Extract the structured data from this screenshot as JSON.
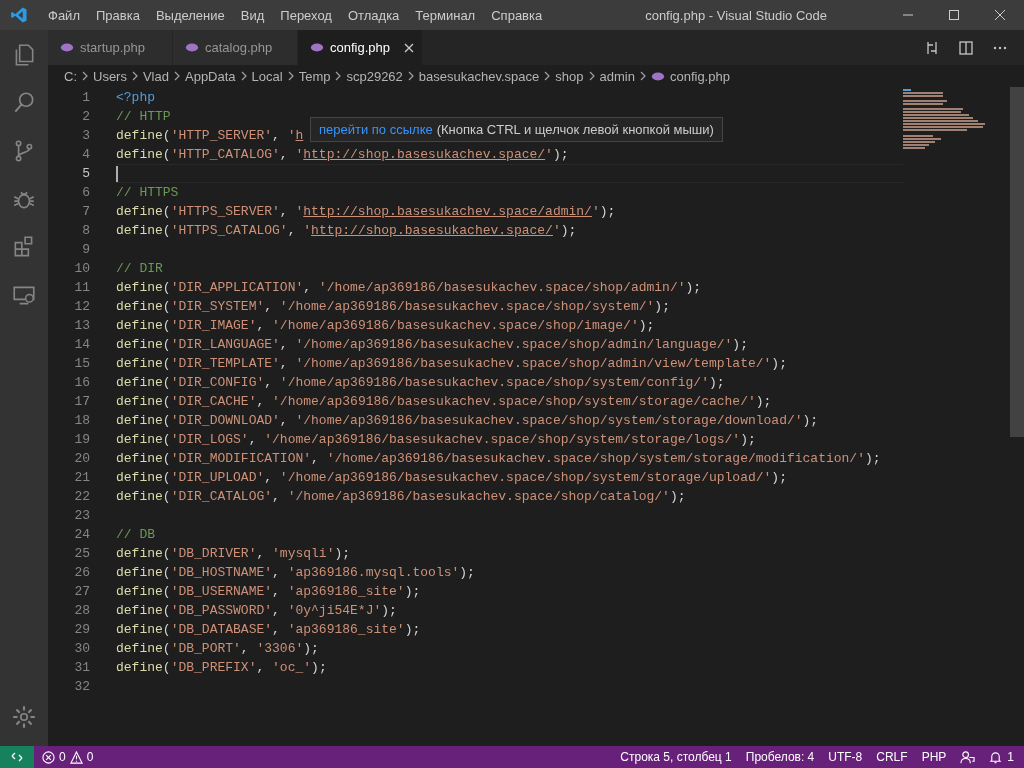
{
  "window": {
    "title": "config.php - Visual Studio Code"
  },
  "menu": [
    "Файл",
    "Правка",
    "Выделение",
    "Вид",
    "Переход",
    "Отладка",
    "Терминал",
    "Справка"
  ],
  "tabs": [
    {
      "label": "startup.php",
      "selected": false
    },
    {
      "label": "catalog.php",
      "selected": false
    },
    {
      "label": "config.php",
      "selected": true
    }
  ],
  "breadcrumbs": [
    "C:",
    "Users",
    "Vlad",
    "AppData",
    "Local",
    "Temp",
    "scp29262",
    "basesukachev.space",
    "shop",
    "admin",
    "config.php"
  ],
  "editor": {
    "lines": [
      {
        "number": "1",
        "current": false,
        "tokens": [
          {
            "kind": "tag",
            "text": "<?php"
          }
        ]
      },
      {
        "number": "2",
        "current": false,
        "tokens": [
          {
            "kind": "comment",
            "text": "// HTTP"
          }
        ]
      },
      {
        "number": "3",
        "current": false,
        "tokens": [
          {
            "kind": "func",
            "text": "define"
          },
          {
            "kind": "punct",
            "text": "("
          },
          {
            "kind": "string",
            "text": "'HTTP_SERVER'"
          },
          {
            "kind": "punct",
            "text": ", "
          },
          {
            "kind": "string",
            "text": "'"
          },
          {
            "kind": "link",
            "text": "h"
          }
        ]
      },
      {
        "number": "4",
        "current": false,
        "tokens": [
          {
            "kind": "func",
            "text": "define"
          },
          {
            "kind": "punct",
            "text": "("
          },
          {
            "kind": "string",
            "text": "'HTTP_CATALOG'"
          },
          {
            "kind": "punct",
            "text": ", "
          },
          {
            "kind": "string",
            "text": "'"
          },
          {
            "kind": "link",
            "text": "http://shop.basesukachev.space/"
          },
          {
            "kind": "string",
            "text": "'"
          },
          {
            "kind": "punct",
            "text": ");"
          }
        ]
      },
      {
        "number": "5",
        "current": true
      },
      {
        "number": "6",
        "current": false,
        "tokens": [
          {
            "kind": "comment",
            "text": "// HTTPS"
          }
        ]
      },
      {
        "number": "7",
        "current": false,
        "tokens": [
          {
            "kind": "func",
            "text": "define"
          },
          {
            "kind": "punct",
            "text": "("
          },
          {
            "kind": "string",
            "text": "'HTTPS_SERVER'"
          },
          {
            "kind": "punct",
            "text": ", "
          },
          {
            "kind": "string",
            "text": "'"
          },
          {
            "kind": "link",
            "text": "http://shop.basesukachev.space/admin/"
          },
          {
            "kind": "string",
            "text": "'"
          },
          {
            "kind": "punct",
            "text": ");"
          }
        ]
      },
      {
        "number": "8",
        "current": false,
        "tokens": [
          {
            "kind": "func",
            "text": "define"
          },
          {
            "kind": "punct",
            "text": "("
          },
          {
            "kind": "string",
            "text": "'HTTPS_CATALOG'"
          },
          {
            "kind": "punct",
            "text": ", "
          },
          {
            "kind": "string",
            "text": "'"
          },
          {
            "kind": "link",
            "text": "http://shop.basesukachev.space/"
          },
          {
            "kind": "string",
            "text": "'"
          },
          {
            "kind": "punct",
            "text": ");"
          }
        ]
      },
      {
        "number": "9",
        "current": false
      },
      {
        "number": "10",
        "current": false,
        "tokens": [
          {
            "kind": "comment",
            "text": "// DIR"
          }
        ]
      },
      {
        "number": "11",
        "current": false,
        "tokens": [
          {
            "kind": "func",
            "text": "define"
          },
          {
            "kind": "punct",
            "text": "("
          },
          {
            "kind": "string",
            "text": "'DIR_APPLICATION'"
          },
          {
            "kind": "punct",
            "text": ", "
          },
          {
            "kind": "string",
            "text": "'/home/ap369186/basesukachev.space/shop/admin/'"
          },
          {
            "kind": "punct",
            "text": ");"
          }
        ]
      },
      {
        "number": "12",
        "current": false,
        "tokens": [
          {
            "kind": "func",
            "text": "define"
          },
          {
            "kind": "punct",
            "text": "("
          },
          {
            "kind": "string",
            "text": "'DIR_SYSTEM'"
          },
          {
            "kind": "punct",
            "text": ", "
          },
          {
            "kind": "string",
            "text": "'/home/ap369186/basesukachev.space/shop/system/'"
          },
          {
            "kind": "punct",
            "text": ");"
          }
        ]
      },
      {
        "number": "13",
        "current": false,
        "tokens": [
          {
            "kind": "func",
            "text": "define"
          },
          {
            "kind": "punct",
            "text": "("
          },
          {
            "kind": "string",
            "text": "'DIR_IMAGE'"
          },
          {
            "kind": "punct",
            "text": ", "
          },
          {
            "kind": "string",
            "text": "'/home/ap369186/basesukachev.space/shop/image/'"
          },
          {
            "kind": "punct",
            "text": ");"
          }
        ]
      },
      {
        "number": "14",
        "current": false,
        "tokens": [
          {
            "kind": "func",
            "text": "define"
          },
          {
            "kind": "punct",
            "text": "("
          },
          {
            "kind": "string",
            "text": "'DIR_LANGUAGE'"
          },
          {
            "kind": "punct",
            "text": ", "
          },
          {
            "kind": "string",
            "text": "'/home/ap369186/basesukachev.space/shop/admin/language/'"
          },
          {
            "kind": "punct",
            "text": ");"
          }
        ]
      },
      {
        "number": "15",
        "current": false,
        "tokens": [
          {
            "kind": "func",
            "text": "define"
          },
          {
            "kind": "punct",
            "text": "("
          },
          {
            "kind": "string",
            "text": "'DIR_TEMPLATE'"
          },
          {
            "kind": "punct",
            "text": ", "
          },
          {
            "kind": "string",
            "text": "'/home/ap369186/basesukachev.space/shop/admin/view/template/'"
          },
          {
            "kind": "punct",
            "text": ");"
          }
        ]
      },
      {
        "number": "16",
        "current": false,
        "tokens": [
          {
            "kind": "func",
            "text": "define"
          },
          {
            "kind": "punct",
            "text": "("
          },
          {
            "kind": "string",
            "text": "'DIR_CONFIG'"
          },
          {
            "kind": "punct",
            "text": ", "
          },
          {
            "kind": "string",
            "text": "'/home/ap369186/basesukachev.space/shop/system/config/'"
          },
          {
            "kind": "punct",
            "text": ");"
          }
        ]
      },
      {
        "number": "17",
        "current": false,
        "tokens": [
          {
            "kind": "func",
            "text": "define"
          },
          {
            "kind": "punct",
            "text": "("
          },
          {
            "kind": "string",
            "text": "'DIR_CACHE'"
          },
          {
            "kind": "punct",
            "text": ", "
          },
          {
            "kind": "string",
            "text": "'/home/ap369186/basesukachev.space/shop/system/storage/cache/'"
          },
          {
            "kind": "punct",
            "text": ");"
          }
        ]
      },
      {
        "number": "18",
        "current": false,
        "tokens": [
          {
            "kind": "func",
            "text": "define"
          },
          {
            "kind": "punct",
            "text": "("
          },
          {
            "kind": "string",
            "text": "'DIR_DOWNLOAD'"
          },
          {
            "kind": "punct",
            "text": ", "
          },
          {
            "kind": "string",
            "text": "'/home/ap369186/basesukachev.space/shop/system/storage/download/'"
          },
          {
            "kind": "punct",
            "text": ");"
          }
        ]
      },
      {
        "number": "19",
        "current": false,
        "tokens": [
          {
            "kind": "func",
            "text": "define"
          },
          {
            "kind": "punct",
            "text": "("
          },
          {
            "kind": "string",
            "text": "'DIR_LOGS'"
          },
          {
            "kind": "punct",
            "text": ", "
          },
          {
            "kind": "string",
            "text": "'/home/ap369186/basesukachev.space/shop/system/storage/logs/'"
          },
          {
            "kind": "punct",
            "text": ");"
          }
        ]
      },
      {
        "number": "20",
        "current": false,
        "tokens": [
          {
            "kind": "func",
            "text": "define"
          },
          {
            "kind": "punct",
            "text": "("
          },
          {
            "kind": "string",
            "text": "'DIR_MODIFICATION'"
          },
          {
            "kind": "punct",
            "text": ", "
          },
          {
            "kind": "string",
            "text": "'/home/ap369186/basesukachev.space/shop/system/storage/modification/'"
          },
          {
            "kind": "punct",
            "text": ");"
          }
        ]
      },
      {
        "number": "21",
        "current": false,
        "tokens": [
          {
            "kind": "func",
            "text": "define"
          },
          {
            "kind": "punct",
            "text": "("
          },
          {
            "kind": "string",
            "text": "'DIR_UPLOAD'"
          },
          {
            "kind": "punct",
            "text": ", "
          },
          {
            "kind": "string",
            "text": "'/home/ap369186/basesukachev.space/shop/system/storage/upload/'"
          },
          {
            "kind": "punct",
            "text": ");"
          }
        ]
      },
      {
        "number": "22",
        "current": false,
        "tokens": [
          {
            "kind": "func",
            "text": "define"
          },
          {
            "kind": "punct",
            "text": "("
          },
          {
            "kind": "string",
            "text": "'DIR_CATALOG'"
          },
          {
            "kind": "punct",
            "text": ", "
          },
          {
            "kind": "string",
            "text": "'/home/ap369186/basesukachev.space/shop/catalog/'"
          },
          {
            "kind": "punct",
            "text": ");"
          }
        ]
      },
      {
        "number": "23",
        "current": false
      },
      {
        "number": "24",
        "current": false,
        "tokens": [
          {
            "kind": "comment",
            "text": "// DB"
          }
        ]
      },
      {
        "number": "25",
        "current": false,
        "tokens": [
          {
            "kind": "func",
            "text": "define"
          },
          {
            "kind": "punct",
            "text": "("
          },
          {
            "kind": "string",
            "text": "'DB_DRIVER'"
          },
          {
            "kind": "punct",
            "text": ", "
          },
          {
            "kind": "string",
            "text": "'mysqli'"
          },
          {
            "kind": "punct",
            "text": ");"
          }
        ]
      },
      {
        "number": "26",
        "current": false,
        "tokens": [
          {
            "kind": "func",
            "text": "define"
          },
          {
            "kind": "punct",
            "text": "("
          },
          {
            "kind": "string",
            "text": "'DB_HOSTNAME'"
          },
          {
            "kind": "punct",
            "text": ", "
          },
          {
            "kind": "string",
            "text": "'ap369186.mysql.tools'"
          },
          {
            "kind": "punct",
            "text": ");"
          }
        ]
      },
      {
        "number": "27",
        "current": false,
        "tokens": [
          {
            "kind": "func",
            "text": "define"
          },
          {
            "kind": "punct",
            "text": "("
          },
          {
            "kind": "string",
            "text": "'DB_USERNAME'"
          },
          {
            "kind": "punct",
            "text": ", "
          },
          {
            "kind": "string",
            "text": "'ap369186_site'"
          },
          {
            "kind": "punct",
            "text": ");"
          }
        ]
      },
      {
        "number": "28",
        "current": false,
        "tokens": [
          {
            "kind": "func",
            "text": "define"
          },
          {
            "kind": "punct",
            "text": "("
          },
          {
            "kind": "string",
            "text": "'DB_PASSWORD'"
          },
          {
            "kind": "punct",
            "text": ", "
          },
          {
            "kind": "string",
            "text": "'0y^ji54E*J'"
          },
          {
            "kind": "punct",
            "text": ");"
          }
        ]
      },
      {
        "number": "29",
        "current": false,
        "tokens": [
          {
            "kind": "func",
            "text": "define"
          },
          {
            "kind": "punct",
            "text": "("
          },
          {
            "kind": "string",
            "text": "'DB_DATABASE'"
          },
          {
            "kind": "punct",
            "text": ", "
          },
          {
            "kind": "string",
            "text": "'ap369186_site'"
          },
          {
            "kind": "punct",
            "text": ");"
          }
        ]
      },
      {
        "number": "30",
        "current": false,
        "tokens": [
          {
            "kind": "func",
            "text": "define"
          },
          {
            "kind": "punct",
            "text": "("
          },
          {
            "kind": "string",
            "text": "'DB_PORT'"
          },
          {
            "kind": "punct",
            "text": ", "
          },
          {
            "kind": "string",
            "text": "'3306'"
          },
          {
            "kind": "punct",
            "text": ");"
          }
        ]
      },
      {
        "number": "31",
        "current": false,
        "tokens": [
          {
            "kind": "func",
            "text": "define"
          },
          {
            "kind": "punct",
            "text": "("
          },
          {
            "kind": "string",
            "text": "'DB_PREFIX'"
          },
          {
            "kind": "punct",
            "text": ", "
          },
          {
            "kind": "string",
            "text": "'oc_'"
          },
          {
            "kind": "punct",
            "text": ");"
          }
        ]
      },
      {
        "number": "32",
        "current": false
      }
    ],
    "hover": {
      "link": "перейти по ссылке",
      "text": "(Кнопка CTRL и щелчок левой кнопкой мыши)"
    }
  },
  "status_bar": {
    "errors": "0",
    "warnings": "0",
    "items": [
      "Строка 5, столбец 1",
      "Пробелов: 4",
      "UTF-8",
      "CRLF",
      "PHP"
    ],
    "notifications": "1"
  }
}
